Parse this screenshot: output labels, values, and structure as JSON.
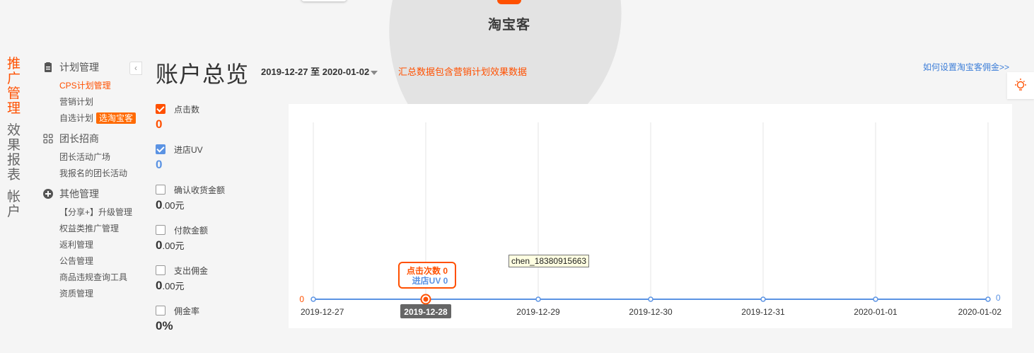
{
  "brand": {
    "name": "淘宝客"
  },
  "vertical_nav": [
    {
      "label": "推广管理",
      "active": true
    },
    {
      "label": "效果报表",
      "active": false
    },
    {
      "label": "帐户",
      "active": false
    }
  ],
  "sidebar": {
    "groups": [
      {
        "title": "计划管理",
        "icon": "clipboard-icon",
        "items": [
          {
            "label": "CPS计划管理",
            "active": true
          },
          {
            "label": "营销计划"
          },
          {
            "label": "自选计划",
            "badge": "选淘宝客"
          }
        ]
      },
      {
        "title": "团长招商",
        "icon": "grid-icon",
        "items": [
          {
            "label": "团长活动广场"
          },
          {
            "label": "我报名的团长活动"
          }
        ]
      },
      {
        "title": "其他管理",
        "icon": "plus-circle-icon",
        "items": [
          {
            "label": "【分享+】升级管理"
          },
          {
            "label": "权益类推广管理"
          },
          {
            "label": "返利管理"
          },
          {
            "label": "公告管理"
          },
          {
            "label": "商品违规查询工具"
          },
          {
            "label": "资质管理"
          }
        ]
      }
    ]
  },
  "header": {
    "title": "账户总览",
    "date_range": "2019-12-27 至 2020-01-02",
    "note": "汇总数据包含营销计划效果数据",
    "help_link": "如何设置淘宝客佣金>>"
  },
  "metrics": [
    {
      "label": "点击数",
      "checked": true,
      "color": "orange",
      "value": "0",
      "unit": ""
    },
    {
      "label": "进店UV",
      "checked": true,
      "color": "blue",
      "value": "0",
      "unit": ""
    },
    {
      "label": "确认收货金额",
      "checked": false,
      "value": "0",
      "unit": ".00元"
    },
    {
      "label": "付款金额",
      "checked": false,
      "value": "0",
      "unit": ".00元"
    },
    {
      "label": "支出佣金",
      "checked": false,
      "value": "0",
      "unit": ".00元"
    },
    {
      "label": "佣金率",
      "checked": false,
      "value": "0%",
      "unit": ""
    }
  ],
  "colors": {
    "accent": "#ff5000",
    "blue": "#5b93e3"
  },
  "chart_data": {
    "type": "line",
    "categories": [
      "2019-12-27",
      "2019-12-28",
      "2019-12-29",
      "2019-12-30",
      "2019-12-31",
      "2020-01-01",
      "2020-01-02"
    ],
    "series": [
      {
        "name": "点击次数",
        "axis": "left",
        "color": "#ff5000",
        "values": [
          0,
          0,
          0,
          0,
          0,
          0,
          0
        ]
      },
      {
        "name": "进店UV",
        "axis": "right",
        "color": "#5b93e3",
        "values": [
          0,
          0,
          0,
          0,
          0,
          0,
          0
        ]
      }
    ],
    "left_axis_label": "0",
    "right_axis_label": "0",
    "hover": {
      "category": "2019-12-28",
      "lines": [
        "点击次数 0",
        "进店UV 0"
      ]
    },
    "grid": "vertical"
  },
  "tooltip_user": "chen_18380915663"
}
